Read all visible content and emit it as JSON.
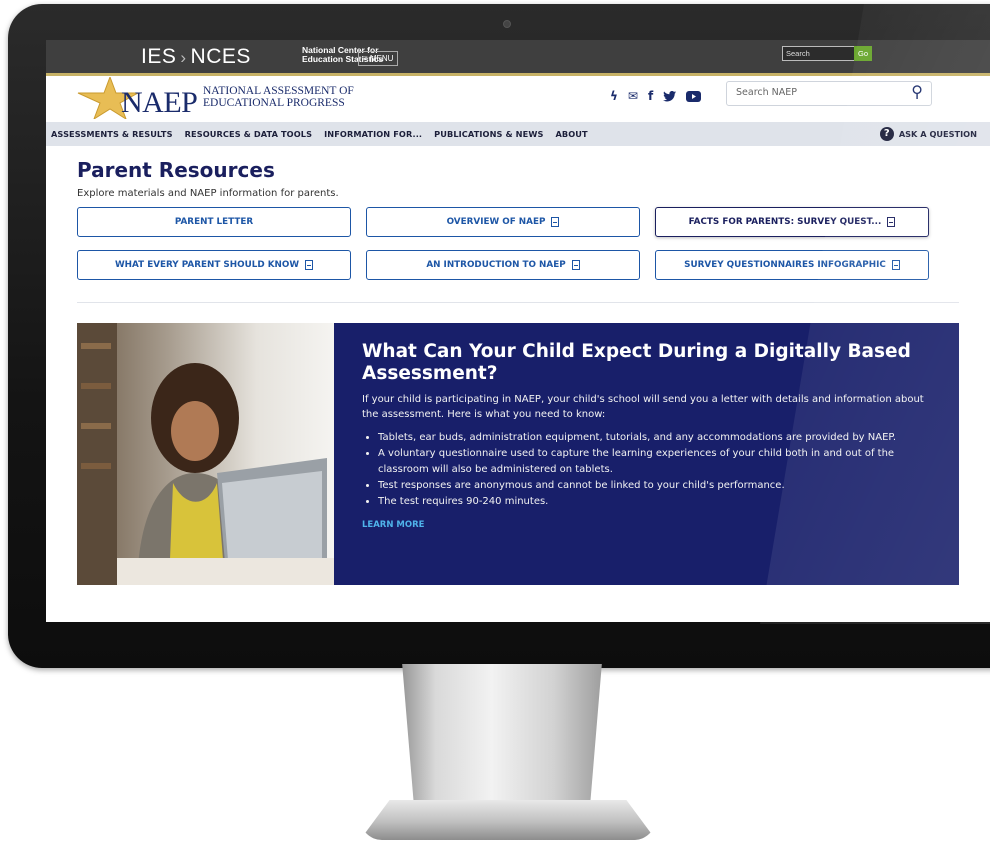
{
  "ies_bar": {
    "logo_ies": "IES",
    "logo_sep": "›",
    "logo_nces": "NCES",
    "nces_line1": "National Center for",
    "nces_line2": "Education Statistics",
    "menu_label": "≡ MENU",
    "search_placeholder": "Search",
    "go_label": "Go"
  },
  "header": {
    "logo_word": "NAEP",
    "logo_line1": "NATIONAL ASSESSMENT OF",
    "logo_line2": "EDUCATIONAL PROGRESS",
    "social_icons": [
      "lightning-icon",
      "email-icon",
      "facebook-icon",
      "twitter-icon",
      "youtube-icon"
    ],
    "search_placeholder": "Search NAEP"
  },
  "nav": {
    "items": [
      "ASSESSMENTS & RESULTS",
      "RESOURCES & DATA TOOLS",
      "INFORMATION FOR...",
      "PUBLICATIONS & NEWS",
      "ABOUT"
    ],
    "ask_label": "ASK A QUESTION"
  },
  "page": {
    "title": "Parent Resources",
    "subtitle": "Explore materials and NAEP information for parents."
  },
  "resources": [
    {
      "label": "PARENT LETTER",
      "doc": false
    },
    {
      "label": "OVERVIEW OF NAEP",
      "doc": true
    },
    {
      "label": "FACTS FOR PARENTS: SURVEY QUEST...",
      "doc": true
    },
    {
      "label": "WHAT EVERY PARENT SHOULD KNOW",
      "doc": true
    },
    {
      "label": "AN INTRODUCTION TO NAEP",
      "doc": true
    },
    {
      "label": "SURVEY QUESTIONNAIRES INFOGRAPHIC",
      "doc": true
    }
  ],
  "feature": {
    "title": "What Can Your Child Expect During a Digitally Based Assessment?",
    "intro": "If your child is participating in NAEP, your child's school will send you a letter with details and information about the assessment. Here is what you need to know:",
    "bullets": [
      "Tablets, ear buds, administration equipment, tutorials, and any accommodations are provided by NAEP.",
      "A voluntary questionnaire used to capture the learning experiences of your child both in and out of the classroom will also be administered on tablets.",
      "Test responses are anonymous and cannot be linked to your child's performance.",
      "The test requires 90-240 minutes."
    ],
    "learn_more": "LEARN MORE"
  },
  "colors": {
    "navy": "#1a1f5e",
    "feature_bg": "#181f6a",
    "link_blue": "#1d56a6",
    "nav_bg": "#dfe3ea",
    "ies_bar": "#3f3f3f",
    "gold": "#c7b266",
    "learn_more": "#4fb3ea"
  }
}
